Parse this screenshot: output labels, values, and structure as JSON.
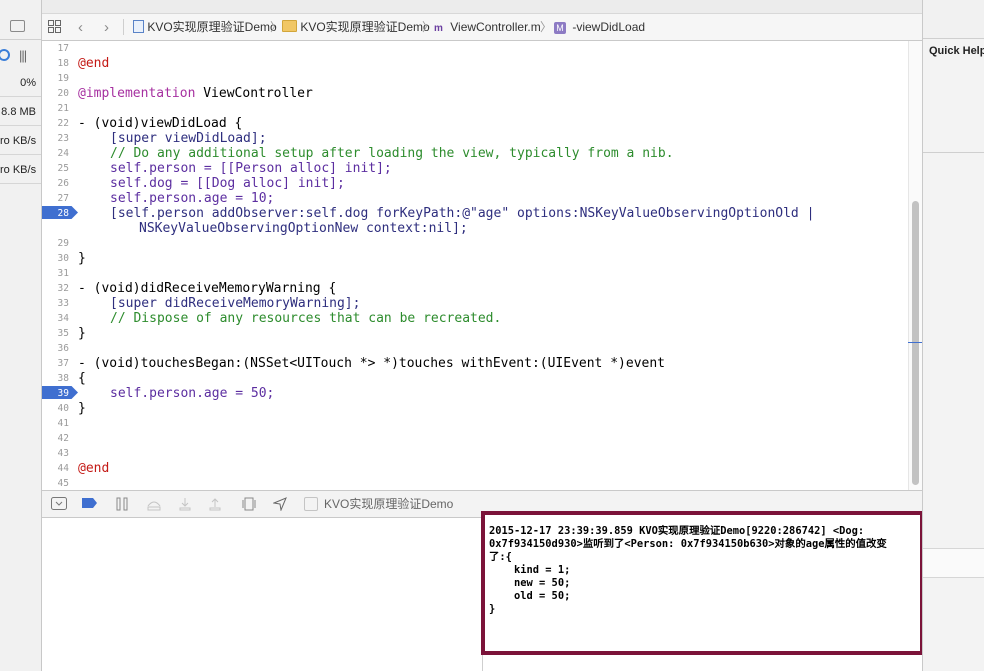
{
  "debug_navigator": {
    "gauges": [
      {
        "name": "cpu",
        "value": "0%"
      },
      {
        "name": "memory",
        "value": "8.8 MB"
      },
      {
        "name": "disk",
        "value": "ro KB/s"
      },
      {
        "name": "network",
        "value": "ro KB/s"
      }
    ]
  },
  "jumpbar": {
    "project": "KVO实现原理验证Demo",
    "group": "KVO实现原理验证Demo",
    "file": "ViewController.m",
    "method": "-viewDidLoad",
    "file_icon_letter": "m",
    "method_icon_letter": "M"
  },
  "editor": {
    "current_line": 28,
    "breakpoint_lines": [
      28,
      39
    ],
    "line_numbers": [
      "17",
      "18",
      "19",
      "20",
      "21",
      "22",
      "23",
      "24",
      "25",
      "26",
      "27",
      "28",
      "",
      "29",
      "30",
      "31",
      "32",
      "33",
      "34",
      "35",
      "36",
      "37",
      "38",
      "39",
      "40",
      "41",
      "42",
      "43",
      "44",
      "45"
    ],
    "lines": {
      "l18": "@end",
      "l20a": "@implementation",
      "l20b": "ViewController",
      "l22": "- (void)viewDidLoad {",
      "l23": "[super viewDidLoad];",
      "l24": "// Do any additional setup after loading the view, typically from a nib.",
      "l25": "self.person = [[Person alloc] init];",
      "l26": "self.dog = [[Dog alloc] init];",
      "l27": "self.person.age = 10;",
      "l28": "[self.person addObserver:self.dog forKeyPath:@\"age\" options:NSKeyValueObservingOptionOld |",
      "l28b": "NSKeyValueObservingOptionNew context:nil];",
      "l30": "}",
      "l32": "- (void)didReceiveMemoryWarning {",
      "l33": "[super didReceiveMemoryWarning];",
      "l34": "// Dispose of any resources that can be recreated.",
      "l35": "}",
      "l37": "- (void)touchesBegan:(NSSet<UITouch *> *)touches withEvent:(UIEvent *)event",
      "l38": "{",
      "l39": "self.person.age = 50;",
      "l40": "}",
      "l44": "@end"
    }
  },
  "debug_bar": {
    "target": "KVO实现原理验证Demo"
  },
  "console": {
    "lines": [
      "2015-12-17 23:39:39.859 KVO实现原理验证Demo[9220:286742] <Dog:",
      "0x7f934150d930>监听到了<Person: 0x7f934150b630>对象的age属性的值改变",
      "了:{",
      "    kind = 1;",
      "    new = 50;",
      "    old = 50;",
      "}"
    ]
  },
  "inspector": {
    "title": "Quick Help"
  },
  "colors": {
    "breakpoint": "#3f6fd0",
    "console_highlight": "#7b1339",
    "keyword": "#a630a0",
    "comment": "#2d8c2d",
    "string": "#c41a16",
    "number": "#2a2ad8"
  }
}
